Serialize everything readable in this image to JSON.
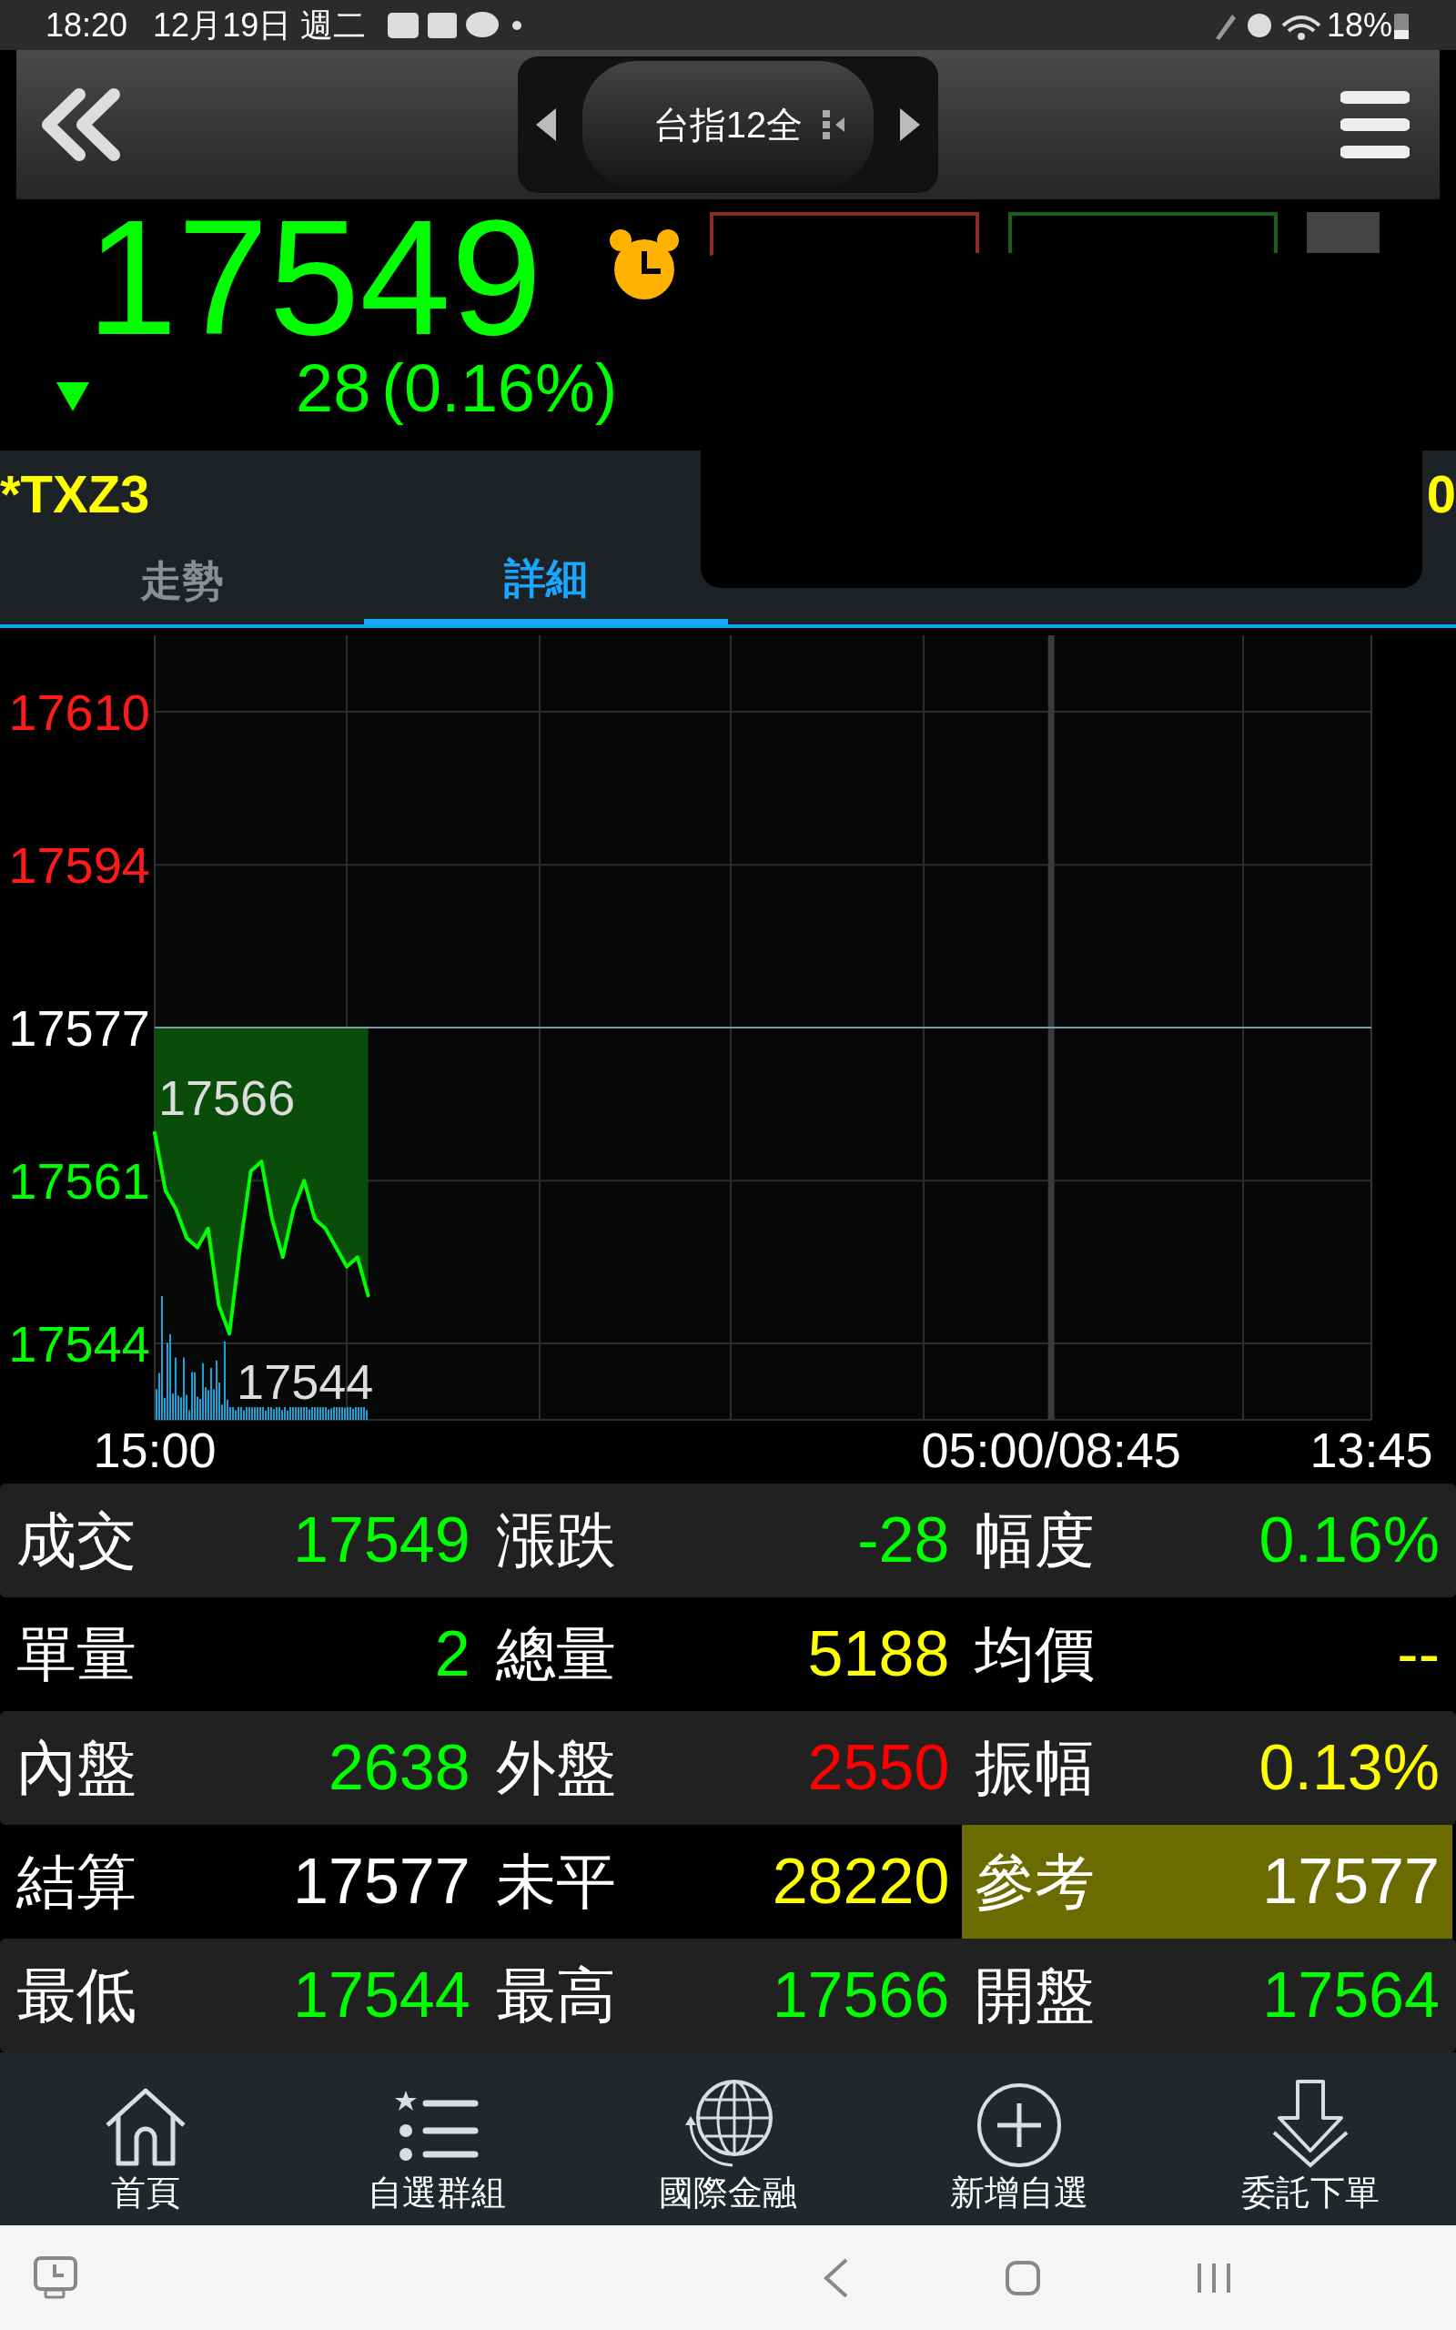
{
  "status_bar": {
    "time": "18:20",
    "date": "12月19日 週二",
    "battery": "18%"
  },
  "header": {
    "symbol_selector": "台指12全"
  },
  "quote": {
    "price": "17549",
    "change": "28",
    "change_percent": "(0.16%)",
    "falling": true
  },
  "symbol_bar": {
    "code": "*TXZ3",
    "right_text": "0"
  },
  "tabs": [
    {
      "label": "走勢",
      "selected": false
    },
    {
      "label": "詳細",
      "selected": true
    }
  ],
  "chart": {
    "chart_data": {
      "type": "line",
      "grid": true,
      "categories": [
        "15:00",
        null,
        null,
        null,
        null,
        null,
        null,
        null,
        null,
        null,
        null,
        null,
        null,
        null,
        null,
        null,
        null,
        null,
        null,
        null,
        null,
        null,
        null,
        null,
        null,
        null,
        null,
        null,
        null,
        null,
        null,
        null,
        null,
        null,
        null,
        null,
        null,
        null,
        null,
        null,
        null,
        null,
        null,
        null,
        null,
        null,
        null,
        null,
        null,
        null,
        null,
        null,
        null,
        null,
        null,
        null,
        null,
        null,
        null,
        null,
        null,
        null,
        null,
        null,
        null,
        null,
        null,
        null,
        null,
        null,
        null,
        null,
        null,
        null,
        null,
        null,
        null,
        null,
        null,
        null,
        null,
        null,
        null,
        null,
        "05:00/08:45",
        null,
        null,
        null,
        null,
        null,
        null,
        null,
        null,
        null,
        null,
        null,
        null,
        null,
        null,
        null,
        null,
        null,
        null,
        null,
        null,
        null,
        null,
        null,
        null,
        null,
        null,
        null,
        null,
        null,
        "13:45"
      ],
      "series": [
        {
          "color": "#00ff00",
          "values": [
            17566,
            17560,
            17558,
            17555,
            17554,
            17556,
            17548,
            17545,
            17554,
            17562,
            17563,
            17557,
            17553,
            17558,
            17561,
            17557,
            17556,
            17554,
            17552,
            17553,
            17549,
            null,
            null,
            null,
            null,
            null,
            null,
            null,
            null,
            null,
            null,
            null,
            null,
            null,
            null,
            null,
            null,
            null,
            null,
            null,
            null,
            null,
            null,
            null,
            null,
            null,
            null,
            null,
            null,
            null,
            null,
            null,
            null,
            null,
            null,
            null,
            null,
            null,
            null,
            null,
            null,
            null,
            null,
            null,
            null,
            null,
            null,
            null,
            null,
            null,
            null,
            null,
            null,
            null,
            null,
            null,
            null,
            null,
            null,
            null,
            null,
            null,
            null,
            null,
            null,
            null,
            null,
            null,
            null,
            null,
            null,
            null,
            null,
            null,
            null,
            null,
            null,
            null,
            null,
            null,
            null,
            null,
            null,
            null,
            null,
            null,
            null,
            null,
            null,
            null,
            null,
            null,
            null,
            null,
            null
          ]
        }
      ],
      "ylim": [
        17536,
        17618
      ],
      "yticks": [
        {
          "value": 17610,
          "label": "17610"
        },
        {
          "value": 17594,
          "label": "17594"
        },
        {
          "value": 17577,
          "label": "17577"
        },
        {
          "value": 17561,
          "label": "17561"
        },
        {
          "value": 17544,
          "label": "17544"
        }
      ],
      "annotations": [
        "17566",
        "17544"
      ]
    }
  },
  "table": {
    "rows": [
      {
        "cells": [
          {
            "label": "成交",
            "value": "17549",
            "color": "#00ff00",
            "highlighted": false
          },
          {
            "label": "漲跌",
            "value": "-28",
            "color": "#00ff00",
            "highlighted": false
          },
          {
            "label": "幅度",
            "value": "0.16%",
            "color": "#00ff00",
            "highlighted": false
          }
        ]
      },
      {
        "cells": [
          {
            "label": "單量",
            "value": "2",
            "color": "#00ff00",
            "highlighted": false
          },
          {
            "label": "總量",
            "value": "5188",
            "color": "#ffff00",
            "highlighted": false
          },
          {
            "label": "均價",
            "value": "--",
            "color": "#ffff00",
            "highlighted": false
          }
        ]
      },
      {
        "cells": [
          {
            "label": "內盤",
            "value": "2638",
            "color": "#00ff00",
            "highlighted": false
          },
          {
            "label": "外盤",
            "value": "2550",
            "color": "#ff0000",
            "highlighted": false
          },
          {
            "label": "振幅",
            "value": "0.13%",
            "color": "#ffff00",
            "highlighted": false
          }
        ]
      },
      {
        "cells": [
          {
            "label": "結算",
            "value": "17577",
            "color": "#ffffff",
            "highlighted": false
          },
          {
            "label": "未平",
            "value": "28220",
            "color": "#ffff00",
            "highlighted": false
          },
          {
            "label": "參考",
            "value": "17577",
            "color": "#ffffff",
            "highlighted": true
          }
        ]
      },
      {
        "cells": [
          {
            "label": "最低",
            "value": "17544",
            "color": "#00ff00",
            "highlighted": false
          },
          {
            "label": "最高",
            "value": "17566",
            "color": "#00ff00",
            "highlighted": false
          },
          {
            "label": "開盤",
            "value": "17564",
            "color": "#00ff00",
            "highlighted": false
          }
        ]
      }
    ]
  },
  "bottom_nav": [
    {
      "label": "首頁"
    },
    {
      "label": "自選群組"
    },
    {
      "label": "國際金融"
    },
    {
      "label": "新增自選"
    },
    {
      "label": "委託下單"
    }
  ]
}
